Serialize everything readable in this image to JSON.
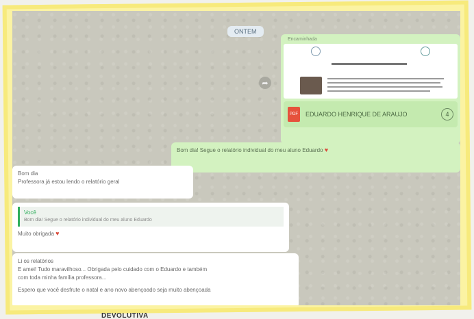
{
  "chat": {
    "date_label": "ONTEM",
    "forwarded_label": "Encaminhada",
    "document": {
      "file_name": "EDUARDO HENRIQUE DE ARAUJO",
      "pages": "4",
      "pdf_badge": "PDF"
    },
    "outgoing_message": {
      "text": "Bom dia! Segue o relatório individual do meu aluno Eduardo",
      "emoji": "♥"
    },
    "incoming_messages": [
      {
        "lines": [
          "Bom dia",
          "Professora já estou lendo o relatório geral"
        ]
      },
      {
        "quote_author": "Você",
        "quote_text": "Bom dia! Segue o relatório individual do meu aluno Eduardo",
        "text": "Muito obrigada",
        "emoji": "♥"
      },
      {
        "lines": [
          "Li os relatórios",
          "E amei! Tudo maravilhoso... Obrigada pelo cuidado com o Eduardo e também",
          "com toda minha família professora...",
          "Espero que você desfrute o natal e ano novo abençoado seja muito abençoada"
        ]
      }
    ]
  },
  "caption": "DEVOLUTIVA"
}
